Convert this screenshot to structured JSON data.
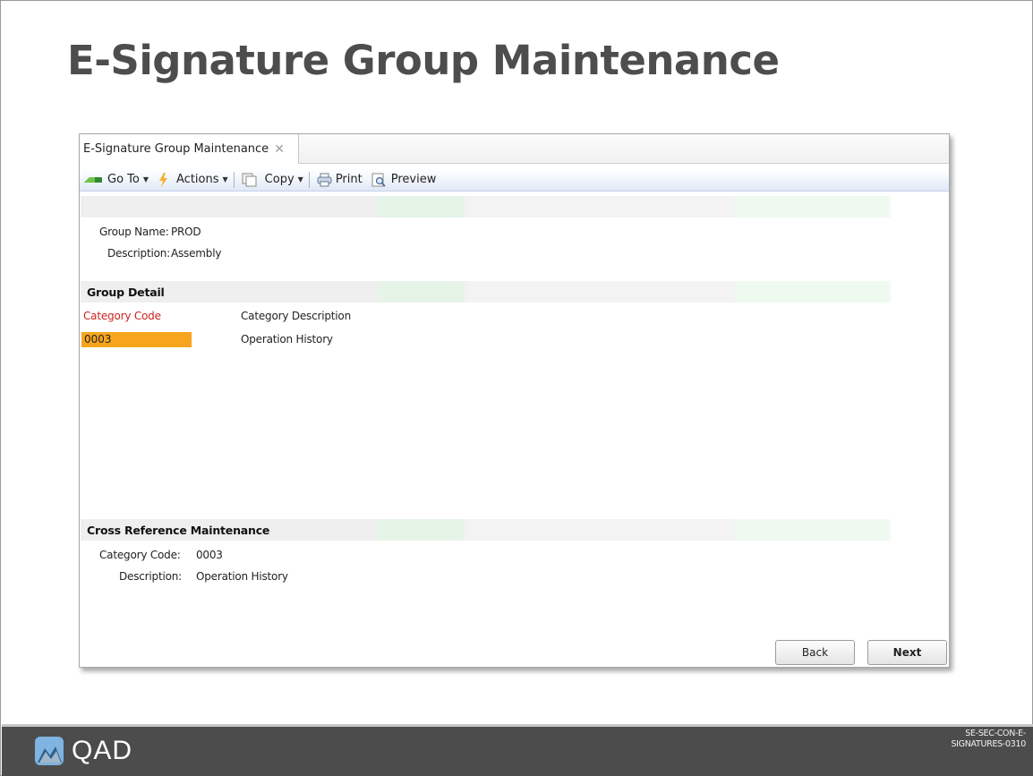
{
  "slide": {
    "title": "E-Signature Group Maintenance",
    "footer_code": "SE-SEC-CON-E-SIGNATURES-0310",
    "logo_text": "QAD"
  },
  "window": {
    "tab": {
      "label": "E-Signature Group Maintenance",
      "close_glyph": "✕"
    },
    "toolbar": {
      "goto_label": "Go To",
      "actions_label": "Actions",
      "copy_label": "Copy",
      "print_label": "Print",
      "preview_label": "Preview"
    },
    "header": {
      "group_name_label": "Group Name:",
      "group_name_value": "PROD",
      "description_label": "Description:",
      "description_value": "Assembly"
    },
    "group_detail": {
      "title": "Group Detail",
      "columns": [
        "Category Code",
        "Category Description"
      ],
      "rows": [
        {
          "code": "0003",
          "description": "Operation History"
        }
      ]
    },
    "cross_reference": {
      "title": "Cross Reference Maintenance",
      "category_code_label": "Category Code:",
      "category_code_value": "0003",
      "description_label": "Description:",
      "description_value": "Operation History"
    },
    "buttons": {
      "back": "Back",
      "next": "Next"
    }
  },
  "colors": {
    "title": "#4d4d4d",
    "selected_cell": "#f7a51c",
    "required_label": "#cc1f1f",
    "footer_bg": "#4c4c4c",
    "logo_blue": "#7fb3e0"
  },
  "icons": [
    "goto-arrow-icon",
    "actions-lightning-icon",
    "copy-icon",
    "printer-icon",
    "preview-icon",
    "close-icon",
    "qad-logo-icon"
  ]
}
